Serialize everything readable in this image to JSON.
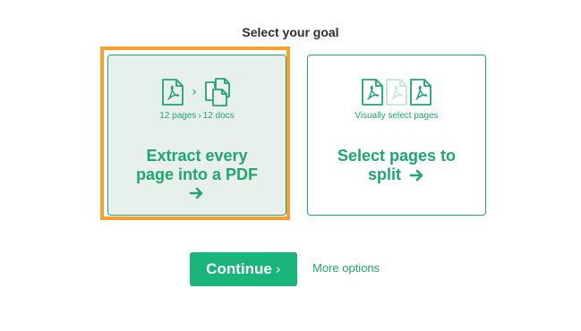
{
  "heading": "Select your goal",
  "options": [
    {
      "caption_left": "12 pages",
      "caption_sep": "›",
      "caption_right": "12 docs",
      "title_line1": "Extract every",
      "title_line2": "page into a PDF",
      "selected": true,
      "icons": [
        "pdf-file-icon",
        "chevron-right-icon",
        "multiple-files-icon"
      ]
    },
    {
      "caption": "Visually select pages",
      "title_line1": "Select pages to",
      "title_line2": "split",
      "selected": false,
      "icons": [
        "pdf-file-icon",
        "pdf-file-faded-icon",
        "pdf-file-icon"
      ]
    }
  ],
  "continue_label": "Continue",
  "continue_chevron": "›",
  "chevron_small": "›",
  "more_options": "More options",
  "colors": {
    "accent": "#1ea672",
    "button": "#19b57a",
    "highlight": "#f7a02b",
    "selected_bg": "#e8f0ec",
    "heading": "#2e2e2e"
  }
}
